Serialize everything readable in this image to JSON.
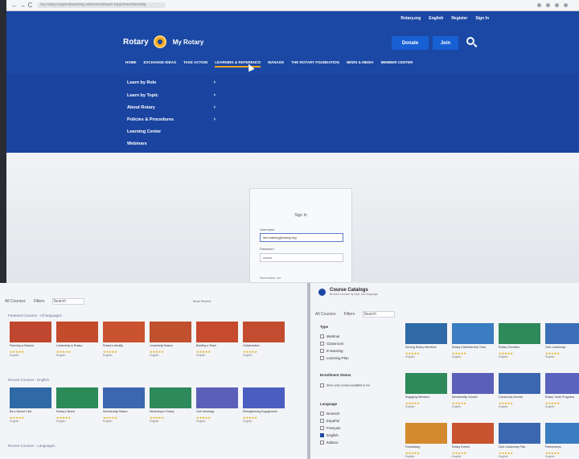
{
  "browser": {
    "url": "my.rotary.org/en/learning-reference/learn-topic/membership",
    "nav": "← → C"
  },
  "site": {
    "utility": [
      "Rotary.org",
      "English",
      "Register",
      "Sign In"
    ],
    "brand": "Rotary",
    "subbrand": "My Rotary",
    "donate": "Donate",
    "join": "Join",
    "nav": [
      "HOME",
      "EXCHANGE IDEAS",
      "TAKE ACTION",
      "LEARNING & REFERENCE",
      "MANAGE",
      "THE ROTARY FOUNDATION",
      "NEWS & MEDIA",
      "MEMBER CENTER"
    ],
    "dropdown": [
      {
        "label": "Learn by Role",
        "chev": "›"
      },
      {
        "label": "Learn by Topic",
        "chev": "›"
      },
      {
        "label": "About Rotary",
        "chev": "›"
      },
      {
        "label": "Policies & Procedures",
        "chev": "›"
      },
      {
        "label": "Learning Center",
        "chev": ""
      },
      {
        "label": "Webinars",
        "chev": ""
      }
    ]
  },
  "login": {
    "title": "Sign In",
    "username_label": "Username",
    "username_value": "info.training@rotary.org",
    "password_label": "Password",
    "password_value": "••••••••",
    "remember": "Remember me"
  },
  "panel_a": {
    "toolbar": [
      "All Courses",
      "Filters",
      "Search"
    ],
    "sort": "Most Recent",
    "sections": [
      "Featured Courses - All languages",
      "Recent Courses - English",
      "Recent Courses - Languages"
    ],
    "cards_row1": [
      {
        "title": "Planning a Session",
        "color": "#c0472f"
      },
      {
        "title": "Leadership in Rotary",
        "color": "#c44a2c"
      },
      {
        "title": "Rotary's Identity",
        "color": "#c9532f"
      },
      {
        "title": "Leadership Basics",
        "color": "#c0502e"
      },
      {
        "title": "Building a Team",
        "color": "#c54a2e"
      },
      {
        "title": "Collaboration",
        "color": "#c34c30"
      }
    ],
    "cards_row2": [
      {
        "title": "Be a Vibrant Club",
        "color": "#2f6aa7"
      },
      {
        "title": "Rotary's Brand",
        "color": "#2b8a58"
      },
      {
        "title": "Membership Basics",
        "color": "#3a67b0"
      },
      {
        "title": "Mentoring in Rotary",
        "color": "#2e8a5a"
      },
      {
        "title": "Club Meetings",
        "color": "#5b5fb8"
      },
      {
        "title": "Strengthening Engagement",
        "color": "#4a5ec0"
      }
    ],
    "rating": "★★★★★",
    "lang": "English"
  },
  "panel_b": {
    "title": "Course Catalogs",
    "subtitle": "Browse courses by topic and language",
    "toolbar": [
      "All Courses",
      "Filters",
      "Search"
    ],
    "filters": {
      "type_title": "Type",
      "type": [
        "Webinar",
        "Classroom",
        "E-learning",
        "Learning Plan"
      ],
      "status_title": "Enrollment Status",
      "status": [
        "Show only courses available to me"
      ],
      "lang_title": "Language",
      "lang": [
        {
          "label": "Deutsch",
          "on": false
        },
        {
          "label": "Español",
          "on": false
        },
        {
          "label": "Français",
          "on": false
        },
        {
          "label": "English",
          "on": true
        },
        {
          "label": "Italiano",
          "on": false
        }
      ]
    },
    "cards": [
      {
        "title": "Serving Rotary Members",
        "color": "#2f6aa7"
      },
      {
        "title": "Rotary's Membership Tools",
        "color": "#3a7dc1"
      },
      {
        "title": "Rotary Overview",
        "color": "#2e8a5a"
      },
      {
        "title": "Club Leadership",
        "color": "#3b6fb9"
      },
      {
        "title": "Engaging Members",
        "color": "#2e8a5a"
      },
      {
        "title": "Membership Growth",
        "color": "#5b5fb8"
      },
      {
        "title": "Community Service",
        "color": "#3a67b0"
      },
      {
        "title": "Rotary Youth Programs",
        "color": "#5a63c0"
      },
      {
        "title": "Fundraising",
        "color": "#d38a2e"
      },
      {
        "title": "Rotary Events",
        "color": "#c9532f"
      },
      {
        "title": "Club Leadership Plan",
        "color": "#3a67b0"
      },
      {
        "title": "Partnerships",
        "color": "#3a7dc1"
      }
    ],
    "rating": "★★★★★",
    "lang": "English"
  }
}
